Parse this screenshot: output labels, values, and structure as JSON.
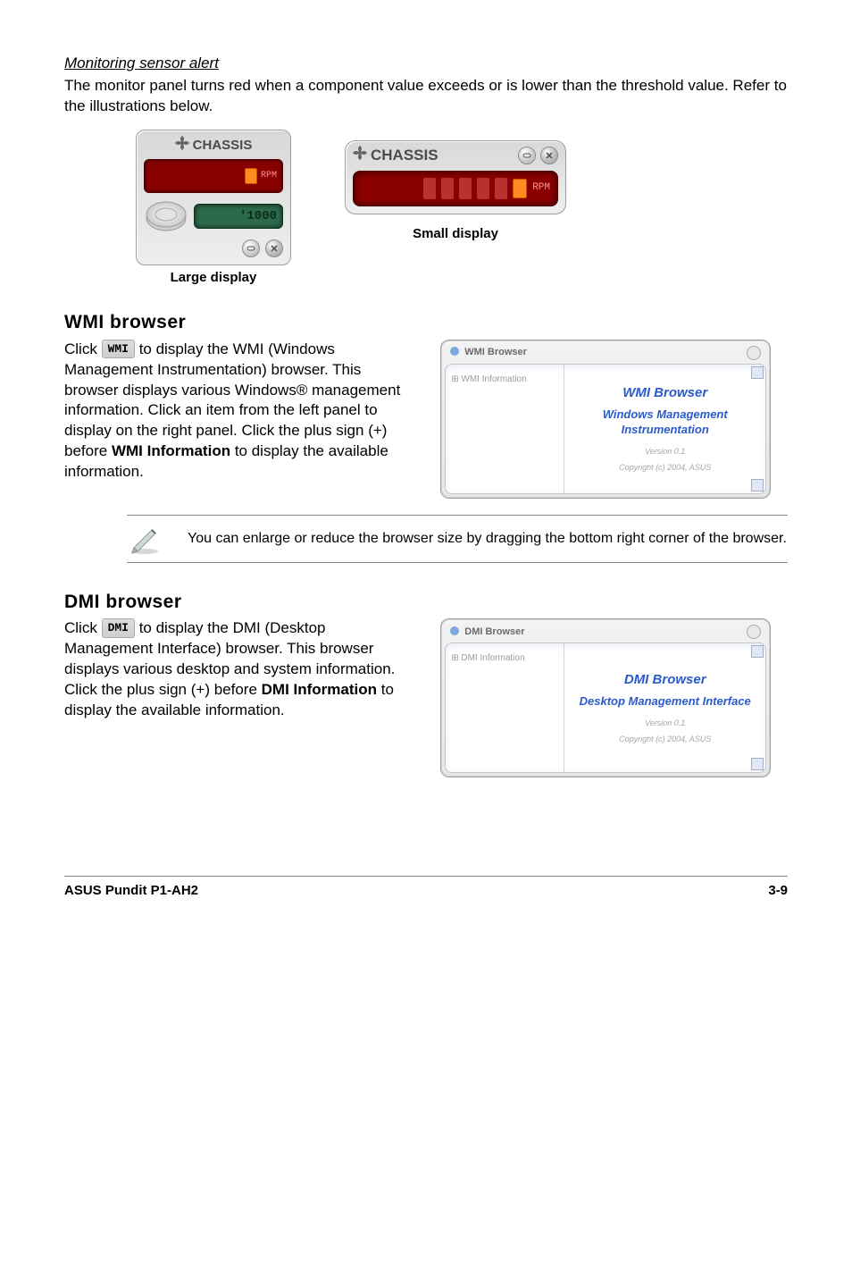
{
  "sensor": {
    "heading": "Monitoring sensor alert",
    "body1": "The monitor panel turns red when a component value exceeds or is lower than the threshold value. Refer to the illustrations below.",
    "large_title": "CHASSIS",
    "large_rpm_label": "RPM",
    "large_threshold": "1000",
    "large_caption": "Large display",
    "small_title": "CHASSIS",
    "small_rpm_label": "RPM",
    "small_caption": "Small display"
  },
  "wmi": {
    "title": "WMI browser",
    "para_a": "Click ",
    "chip": "WMI",
    "para_b": " to display the WMI (Windows Management Instrumentation) browser. This browser displays various Windows® management information. Click an item from the left panel to display on the right panel. Click the plus sign (+) before ",
    "bold": "WMI Information",
    "para_c": " to display the available information.",
    "win_title": "WMI Browser",
    "tree_root": "WMI Information",
    "right_heading": "WMI  Browser",
    "right_sub": "Windows Management Instrumentation",
    "right_ver": "Version 0.1",
    "right_copy": "Copyright (c) 2004, ASUS"
  },
  "note": {
    "text": "You can enlarge or reduce the browser size by dragging the bottom right corner of the browser."
  },
  "dmi": {
    "title": "DMI browser",
    "para_a": "Click ",
    "chip": "DMI",
    "para_b": " to display the DMI (Desktop Management Interface) browser. This browser displays various desktop and system information. Click the plus sign (+) before ",
    "bold": "DMI Information",
    "para_c": " to display the available information.",
    "win_title": "DMI Browser",
    "tree_root": "DMI Information",
    "right_heading": "DMI  Browser",
    "right_sub": "Desktop Management Interface",
    "right_ver": "Version 0.1",
    "right_copy": "Copyright (c) 2004, ASUS"
  },
  "footer": {
    "left": "ASUS Pundit P1-AH2",
    "right": "3-9"
  }
}
